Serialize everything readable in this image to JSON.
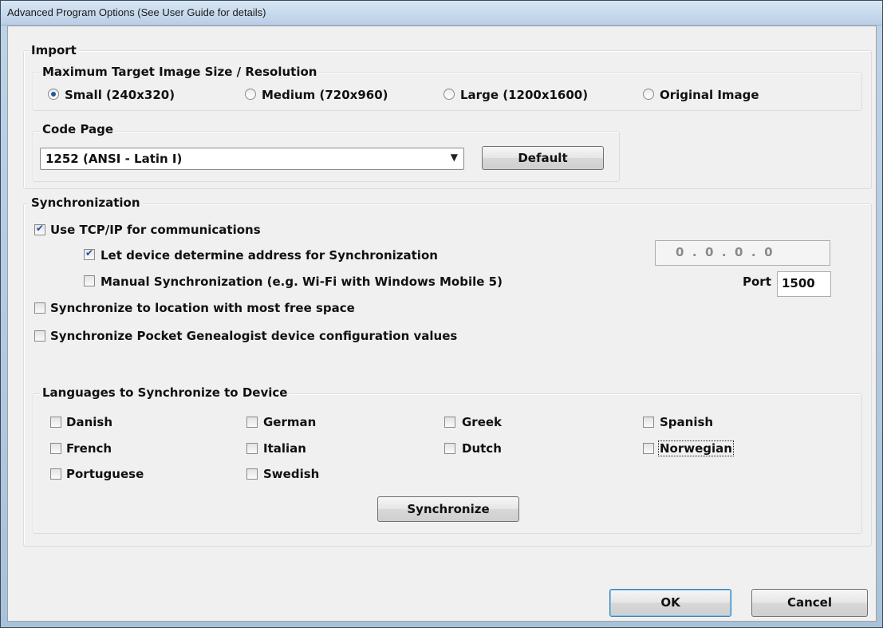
{
  "window": {
    "title": "Advanced Program Options (See User Guide for details)"
  },
  "import": {
    "label": "Import",
    "resolution": {
      "label": "Maximum Target Image Size / Resolution",
      "options": [
        "Small (240x320)",
        "Medium (720x960)",
        "Large (1200x1600)",
        "Original Image"
      ],
      "selected": "Small (240x320)"
    },
    "code_page": {
      "label": "Code Page",
      "value": "1252  (ANSI - Latin I)",
      "default_label": "Default"
    }
  },
  "sync": {
    "label": "Synchronization",
    "tcpip": {
      "label": "Use TCP/IP for communications",
      "checked": true
    },
    "let_device": {
      "label": "Let device determine address for Synchronization",
      "checked": true
    },
    "ip_address": "0  .  0  .  0  .  0",
    "manual": {
      "label": "Manual Synchronization (e.g. Wi-Fi with Windows Mobile 5)",
      "checked": false
    },
    "port_label": "Port",
    "port_value": "1500",
    "most_free": {
      "label": "Synchronize to location with most free space",
      "checked": false
    },
    "pg_config": {
      "label": "Synchronize Pocket Genealogist device configuration values",
      "checked": false
    }
  },
  "languages": {
    "label": "Languages to Synchronize to Device",
    "items": [
      "Danish",
      "German",
      "Greek",
      "Spanish",
      "French",
      "Italian",
      "Dutch",
      "Norwegian",
      "Portuguese",
      "Swedish"
    ],
    "synchronize_label": "Synchronize"
  },
  "footer": {
    "ok_label": "OK",
    "cancel_label": "Cancel"
  },
  "colors": {
    "accent": "#1e5a9e",
    "primary_button_border": "#3c7fb1",
    "window_frame": "#bfd3e8"
  }
}
